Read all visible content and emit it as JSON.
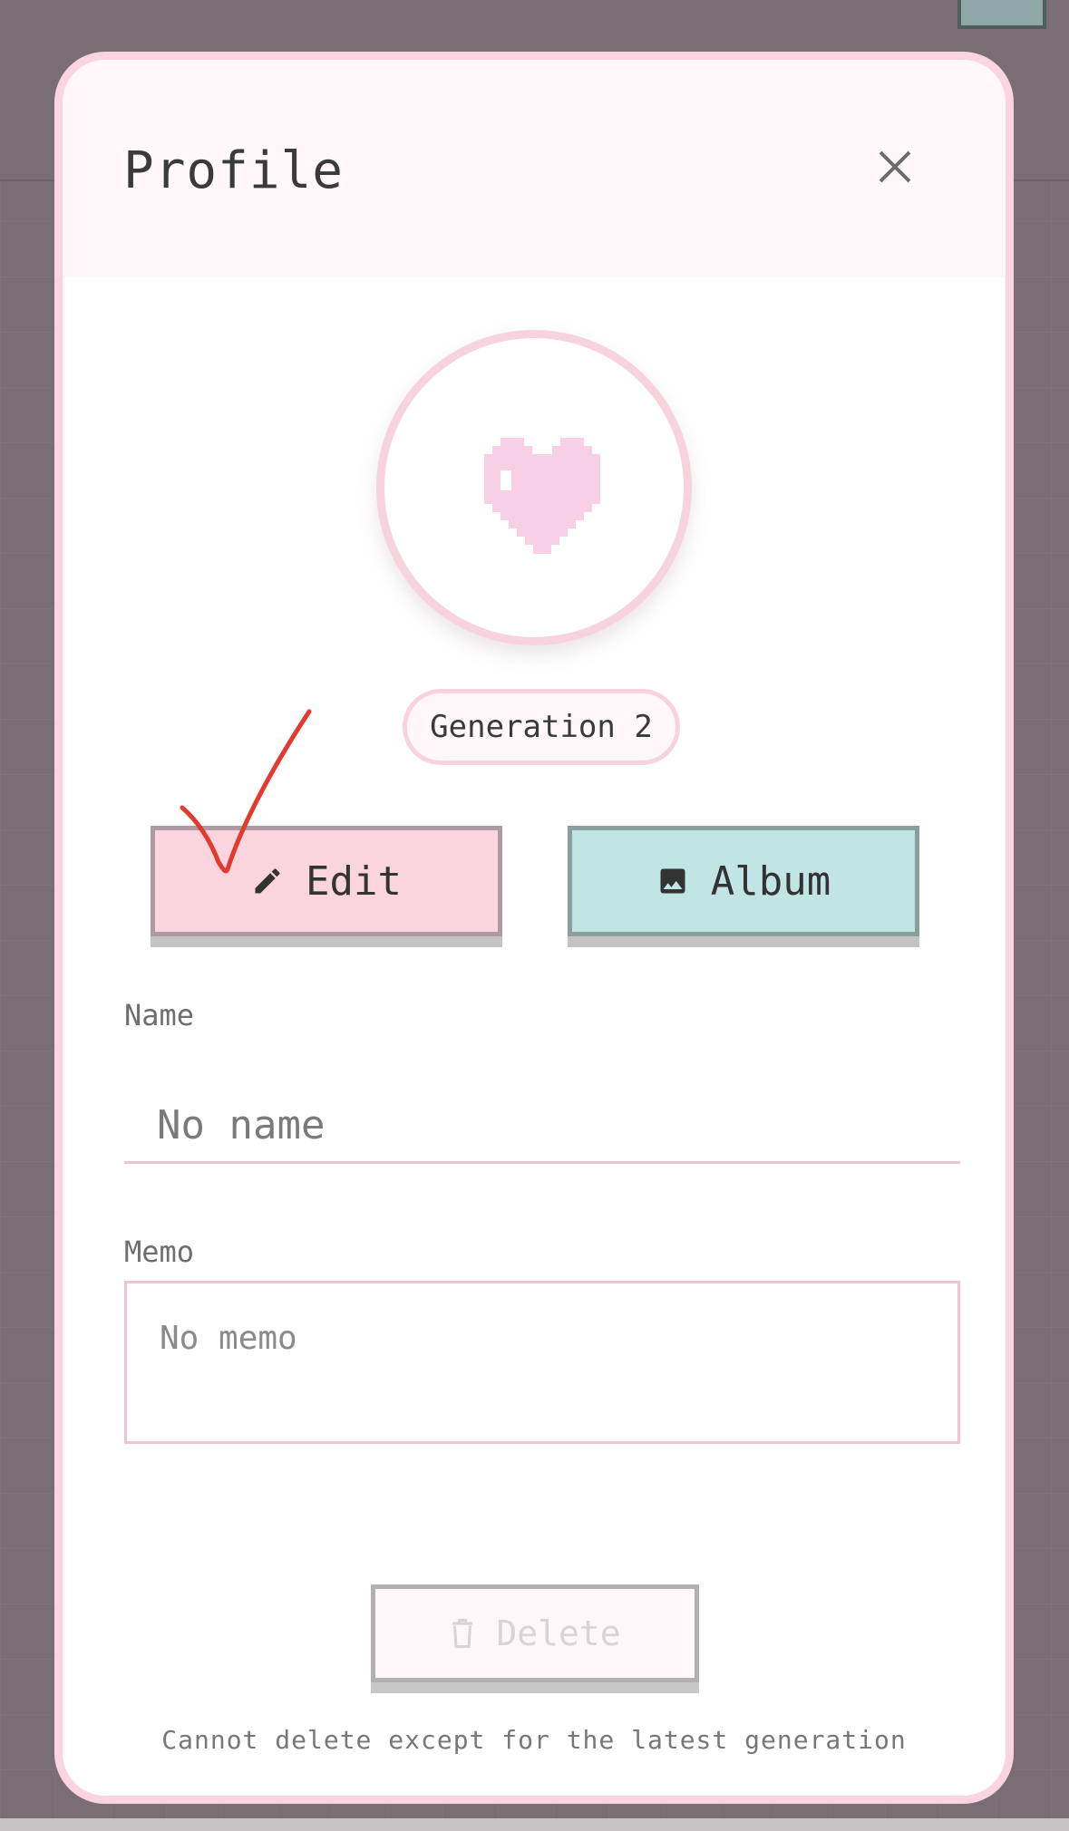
{
  "modal": {
    "title": "Profile",
    "close_icon": "close-icon"
  },
  "avatar": {
    "icon": "pixel-heart-icon"
  },
  "generation_badge": "Generation 2",
  "actions": {
    "edit_label": "Edit",
    "edit_icon": "pencil-icon",
    "album_label": "Album",
    "album_icon": "image-icon"
  },
  "fields": {
    "name_label": "Name",
    "name_value": "",
    "name_placeholder": "No name",
    "memo_label": "Memo",
    "memo_value": "",
    "memo_placeholder": "No memo"
  },
  "delete": {
    "label": "Delete",
    "icon": "trash-icon",
    "disabled": true,
    "note": "Cannot delete except for the latest generation"
  },
  "annotation": {
    "icon": "checkmark-annotation"
  },
  "colors": {
    "modal_border": "#fad4e0",
    "edit_button": "#fbd5de",
    "album_button": "#c1e4e5",
    "heart": "#f8d0e6",
    "annotation": "#e23a2e"
  }
}
